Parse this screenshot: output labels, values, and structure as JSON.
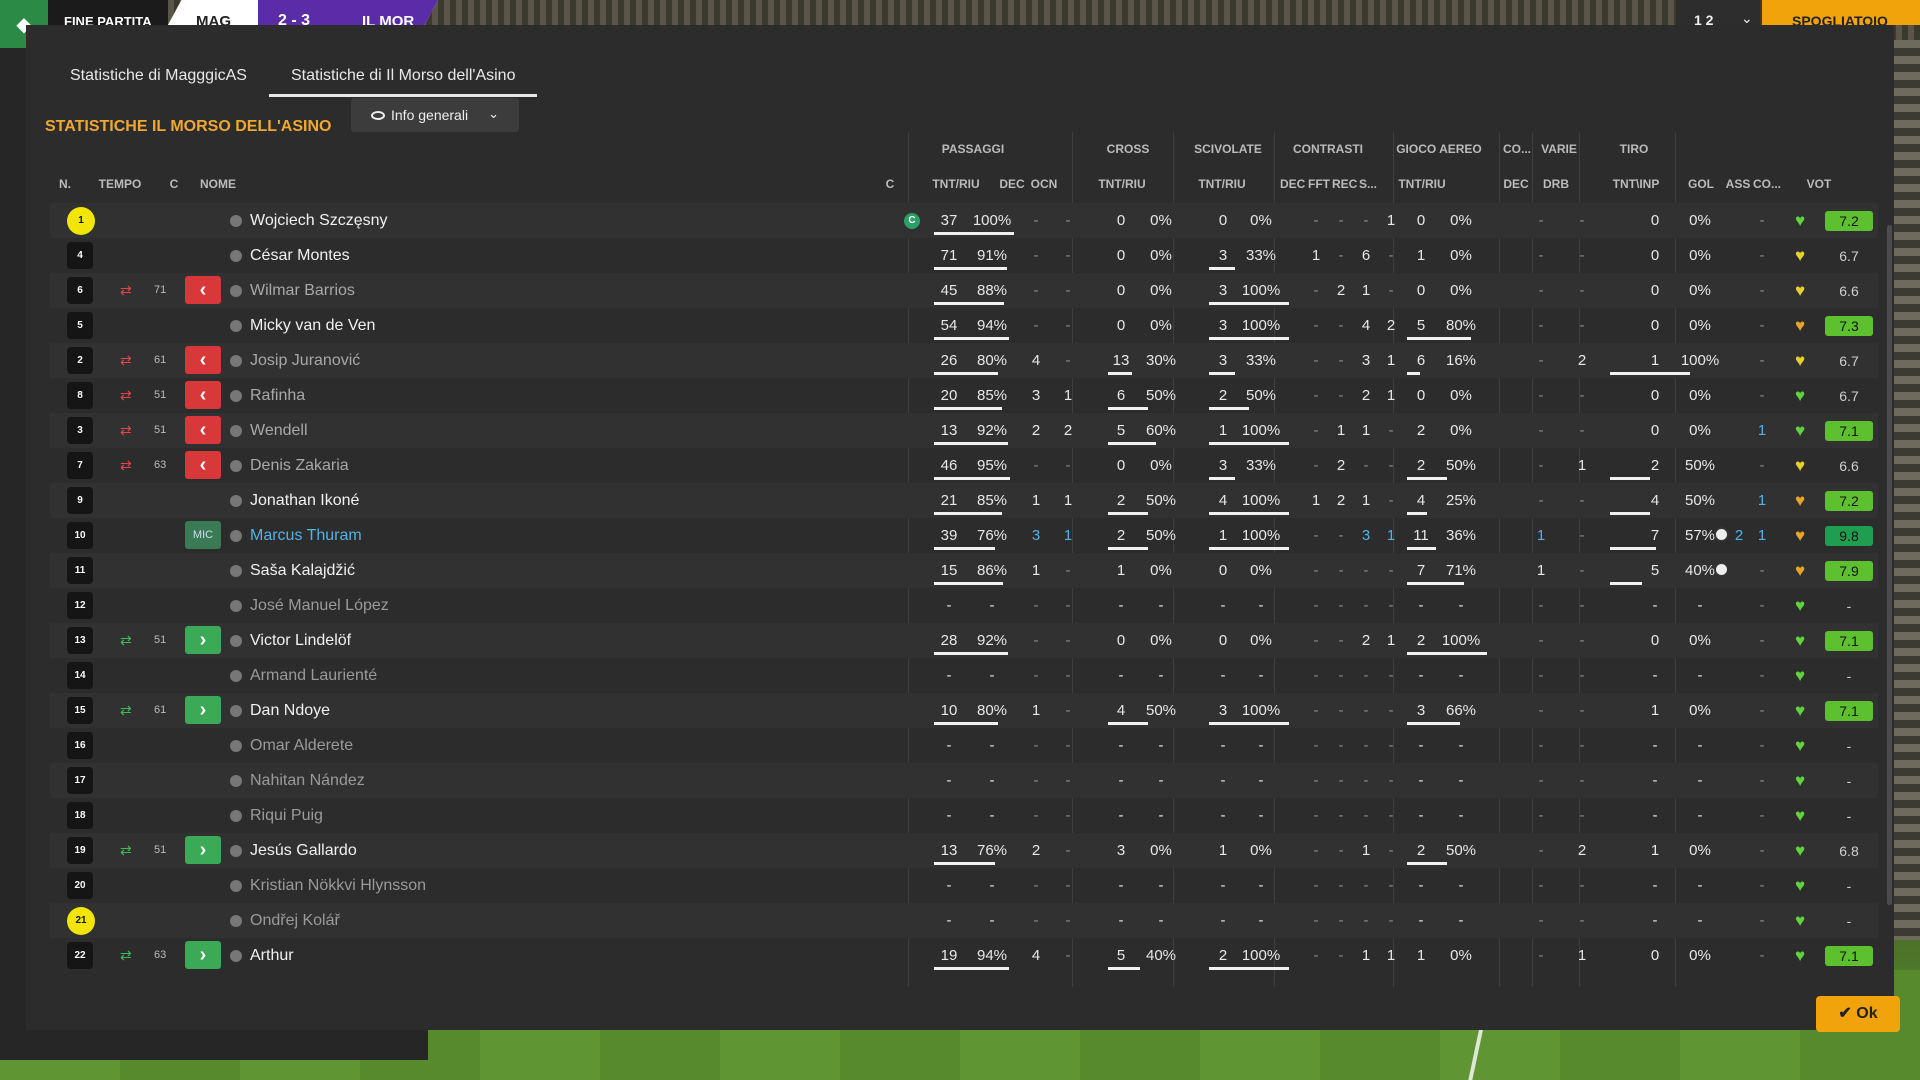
{
  "topbar": {
    "status": "FINE PARTITA",
    "home_abbr": "MAG",
    "score": "2 - 3",
    "away_abbr": "IL MOR",
    "btn_count": "1 2",
    "btn_chevron": "⌄",
    "btn_action": "SPOGLIATOIO"
  },
  "tabs": [
    "Statistiche di MagggicAS",
    "Statistiche di Il Morso dell'Asino"
  ],
  "heading": "STATISTICHE IL MORSO DELL'ASINO",
  "dropdown": "Info generali",
  "group_headers": [
    "PASSAGGI",
    "CROSS",
    "SCIVOLATE",
    "CONTRASTI",
    "GIOCO AEREO",
    "CO...",
    "VARIE",
    "TIRO"
  ],
  "col_headers": [
    "N.",
    "TEMPO",
    "C",
    "NOME",
    "C",
    "TNT/RIU",
    "DEC",
    "OCN",
    "TNT/RIU",
    "TNT/RIU",
    "DEC",
    "FFT",
    "REC",
    "S...",
    "TNT/RIU",
    "DEC",
    "DRB",
    "TNT\\INP",
    "GOL",
    "ASS",
    "CO...",
    "VOT"
  ],
  "colors": {
    "accent": "#f0a830",
    "sub_in": "#3ba955",
    "sub_out": "#d8383a",
    "gk": "#f2e600"
  },
  "rows": [
    {
      "n": "1",
      "gk": true,
      "sub": "",
      "min": "",
      "tag": "",
      "name": "Wojciech Szczęsny",
      "style": "",
      "cap": "C",
      "pass": [
        "37",
        "100%"
      ],
      "pdec": "-",
      "pocn": "-",
      "cross": [
        "0",
        "0%"
      ],
      "slide": [
        "0",
        "0%"
      ],
      "tack": [
        "-",
        "-",
        "-",
        "1"
      ],
      "aer": [
        "0",
        "0%"
      ],
      "co": "-",
      "drb": "-",
      "shot": [
        "0",
        "0%"
      ],
      "gol": "",
      "ass": "-",
      "heart": "green",
      "vot": "7.2",
      "votc": "#5dc12f",
      "pb": 100,
      "cb": 0,
      "sb": 0,
      "ab": 0,
      "tb": 0
    },
    {
      "n": "4",
      "gk": false,
      "sub": "",
      "min": "",
      "tag": "",
      "name": "César Montes",
      "style": "",
      "cap": "",
      "pass": [
        "71",
        "91%"
      ],
      "pdec": "-",
      "pocn": "-",
      "cross": [
        "0",
        "0%"
      ],
      "slide": [
        "3",
        "33%"
      ],
      "tack": [
        "1",
        "-",
        "6",
        "-"
      ],
      "aer": [
        "1",
        "0%"
      ],
      "co": "-",
      "drb": "-",
      "shot": [
        "0",
        "0%"
      ],
      "gol": "",
      "ass": "-",
      "heart": "yellow",
      "vot": "6.7",
      "votc": "",
      "pb": 91,
      "cb": 0,
      "sb": 33,
      "ab": 0,
      "tb": 0
    },
    {
      "n": "6",
      "gk": false,
      "sub": "out",
      "min": "71",
      "tag": "",
      "name": "Wilmar Barrios",
      "style": "subbed",
      "cap": "",
      "pass": [
        "45",
        "88%"
      ],
      "pdec": "-",
      "pocn": "-",
      "cross": [
        "0",
        "0%"
      ],
      "slide": [
        "3",
        "100%"
      ],
      "tack": [
        "-",
        "2",
        "1",
        "-"
      ],
      "aer": [
        "0",
        "0%"
      ],
      "co": "-",
      "drb": "-",
      "shot": [
        "0",
        "0%"
      ],
      "gol": "",
      "ass": "-",
      "heart": "yellow",
      "vot": "6.6",
      "votc": "",
      "pb": 88,
      "cb": 0,
      "sb": 100,
      "ab": 0,
      "tb": 0
    },
    {
      "n": "5",
      "gk": false,
      "sub": "",
      "min": "",
      "tag": "",
      "name": "Micky van de Ven",
      "style": "",
      "cap": "",
      "pass": [
        "54",
        "94%"
      ],
      "pdec": "-",
      "pocn": "-",
      "cross": [
        "0",
        "0%"
      ],
      "slide": [
        "3",
        "100%"
      ],
      "tack": [
        "-",
        "-",
        "4",
        "2"
      ],
      "aer": [
        "5",
        "80%"
      ],
      "co": "-",
      "drb": "-",
      "shot": [
        "0",
        "0%"
      ],
      "gol": "",
      "ass": "-",
      "heart": "orange",
      "vot": "7.3",
      "votc": "#5dc12f",
      "pb": 94,
      "cb": 0,
      "sb": 100,
      "ab": 80,
      "tb": 0
    },
    {
      "n": "2",
      "gk": false,
      "sub": "out",
      "min": "61",
      "tag": "",
      "name": "Josip Juranović",
      "style": "subbed",
      "cap": "",
      "pass": [
        "26",
        "80%"
      ],
      "pdec": "4",
      "pocn": "-",
      "cross": [
        "13",
        "30%"
      ],
      "slide": [
        "3",
        "33%"
      ],
      "tack": [
        "-",
        "-",
        "3",
        "1"
      ],
      "aer": [
        "6",
        "16%"
      ],
      "co": "-",
      "drb": "2",
      "shot": [
        "1",
        "100%"
      ],
      "gol": "",
      "ass": "-",
      "heart": "yellow",
      "vot": "6.7",
      "votc": "",
      "pb": 80,
      "cb": 30,
      "sb": 33,
      "ab": 16,
      "tb": 100
    },
    {
      "n": "8",
      "gk": false,
      "sub": "out",
      "min": "51",
      "tag": "",
      "name": "Rafinha",
      "style": "subbed",
      "cap": "",
      "pass": [
        "20",
        "85%"
      ],
      "pdec": "3",
      "pocn": "1",
      "cross": [
        "6",
        "50%"
      ],
      "slide": [
        "2",
        "50%"
      ],
      "tack": [
        "-",
        "-",
        "2",
        "1"
      ],
      "aer": [
        "0",
        "0%"
      ],
      "co": "-",
      "drb": "-",
      "shot": [
        "0",
        "0%"
      ],
      "gol": "",
      "ass": "-",
      "heart": "green",
      "vot": "6.7",
      "votc": "",
      "pb": 85,
      "cb": 50,
      "sb": 50,
      "ab": 0,
      "tb": 0
    },
    {
      "n": "3",
      "gk": false,
      "sub": "out",
      "min": "51",
      "tag": "",
      "name": "Wendell",
      "style": "subbed",
      "cap": "",
      "pass": [
        "13",
        "92%"
      ],
      "pdec": "2",
      "pocn": "2",
      "cross": [
        "5",
        "60%"
      ],
      "slide": [
        "1",
        "100%"
      ],
      "tack": [
        "-",
        "1",
        "1",
        "-"
      ],
      "aer": [
        "2",
        "0%"
      ],
      "co": "-",
      "drb": "-",
      "shot": [
        "0",
        "0%"
      ],
      "gol": "",
      "ass": "1",
      "heart": "green",
      "vot": "7.1",
      "votc": "#5dc12f",
      "pb": 92,
      "cb": 60,
      "sb": 100,
      "ab": 0,
      "tb": 0
    },
    {
      "n": "7",
      "gk": false,
      "sub": "out",
      "min": "63",
      "tag": "",
      "name": "Denis Zakaria",
      "style": "subbed",
      "cap": "",
      "pass": [
        "46",
        "95%"
      ],
      "pdec": "-",
      "pocn": "-",
      "cross": [
        "0",
        "0%"
      ],
      "slide": [
        "3",
        "33%"
      ],
      "tack": [
        "-",
        "2",
        "-",
        "-"
      ],
      "aer": [
        "2",
        "50%"
      ],
      "co": "-",
      "drb": "1",
      "shot": [
        "2",
        "50%"
      ],
      "gol": "",
      "ass": "-",
      "heart": "yellow",
      "vot": "6.6",
      "votc": "",
      "pb": 95,
      "cb": 0,
      "sb": 33,
      "ab": 50,
      "tb": 50
    },
    {
      "n": "9",
      "gk": false,
      "sub": "",
      "min": "",
      "tag": "",
      "name": "Jonathan Ikoné",
      "style": "",
      "cap": "",
      "pass": [
        "21",
        "85%"
      ],
      "pdec": "1",
      "pocn": "1",
      "cross": [
        "2",
        "50%"
      ],
      "slide": [
        "4",
        "100%"
      ],
      "tack": [
        "1",
        "2",
        "1",
        "-"
      ],
      "aer": [
        "4",
        "25%"
      ],
      "co": "-",
      "drb": "-",
      "shot": [
        "4",
        "50%"
      ],
      "gol": "",
      "ass": "1",
      "heart": "orange",
      "vot": "7.2",
      "votc": "#5dc12f",
      "pb": 85,
      "cb": 50,
      "sb": 100,
      "ab": 25,
      "tb": 50
    },
    {
      "n": "10",
      "gk": false,
      "sub": "",
      "min": "",
      "tag": "MIC",
      "name": "Marcus Thuram",
      "style": "star",
      "cap": "",
      "pass": [
        "39",
        "76%"
      ],
      "pdec": "3",
      "pocn": "1",
      "cross": [
        "2",
        "50%"
      ],
      "slide": [
        "1",
        "100%"
      ],
      "tack": [
        "-",
        "-",
        "3",
        "1"
      ],
      "aer": [
        "11",
        "36%"
      ],
      "co": "1",
      "drb": "-",
      "shot": [
        "7",
        "57%"
      ],
      "gol": "2",
      "ass": "1",
      "heart": "orange",
      "vot": "9.8",
      "votc": "#1f9e4f",
      "pb": 76,
      "cb": 50,
      "sb": 100,
      "ab": 36,
      "tb": 57
    },
    {
      "n": "11",
      "gk": false,
      "sub": "",
      "min": "",
      "tag": "",
      "name": "Saša Kalajdžić",
      "style": "",
      "cap": "",
      "pass": [
        "15",
        "86%"
      ],
      "pdec": "1",
      "pocn": "-",
      "cross": [
        "1",
        "0%"
      ],
      "slide": [
        "0",
        "0%"
      ],
      "tack": [
        "-",
        "-",
        "-",
        "-"
      ],
      "aer": [
        "7",
        "71%"
      ],
      "co": "1",
      "drb": "-",
      "shot": [
        "5",
        "40%"
      ],
      "gol": "1",
      "ass": "-",
      "heart": "orange",
      "vot": "7.9",
      "votc": "#5dc12f",
      "pb": 86,
      "cb": 0,
      "sb": 0,
      "ab": 71,
      "tb": 40
    },
    {
      "n": "12",
      "gk": false,
      "sub": "",
      "min": "",
      "tag": "",
      "name": "José Manuel López",
      "style": "unused",
      "cap": "",
      "pass": [
        "-",
        "-"
      ],
      "pdec": "-",
      "pocn": "-",
      "cross": [
        "-",
        "-"
      ],
      "slide": [
        "-",
        "-"
      ],
      "tack": [
        "-",
        "-",
        "-",
        "-"
      ],
      "aer": [
        "-",
        "-"
      ],
      "co": "-",
      "drb": "-",
      "shot": [
        "-",
        "-"
      ],
      "gol": "",
      "ass": "-",
      "heart": "green",
      "vot": "-",
      "votc": "",
      "pb": 0,
      "cb": 0,
      "sb": 0,
      "ab": 0,
      "tb": 0
    },
    {
      "n": "13",
      "gk": false,
      "sub": "in",
      "min": "51",
      "tag": "",
      "name": "Victor Lindelöf",
      "style": "",
      "cap": "",
      "pass": [
        "28",
        "92%"
      ],
      "pdec": "-",
      "pocn": "-",
      "cross": [
        "0",
        "0%"
      ],
      "slide": [
        "0",
        "0%"
      ],
      "tack": [
        "-",
        "-",
        "2",
        "1"
      ],
      "aer": [
        "2",
        "100%"
      ],
      "co": "-",
      "drb": "-",
      "shot": [
        "0",
        "0%"
      ],
      "gol": "",
      "ass": "-",
      "heart": "green",
      "vot": "7.1",
      "votc": "#5dc12f",
      "pb": 92,
      "cb": 0,
      "sb": 0,
      "ab": 100,
      "tb": 0
    },
    {
      "n": "14",
      "gk": false,
      "sub": "",
      "min": "",
      "tag": "",
      "name": "Armand Laurienté",
      "style": "unused",
      "cap": "",
      "pass": [
        "-",
        "-"
      ],
      "pdec": "-",
      "pocn": "-",
      "cross": [
        "-",
        "-"
      ],
      "slide": [
        "-",
        "-"
      ],
      "tack": [
        "-",
        "-",
        "-",
        "-"
      ],
      "aer": [
        "-",
        "-"
      ],
      "co": "-",
      "drb": "-",
      "shot": [
        "-",
        "-"
      ],
      "gol": "",
      "ass": "-",
      "heart": "green",
      "vot": "-",
      "votc": "",
      "pb": 0,
      "cb": 0,
      "sb": 0,
      "ab": 0,
      "tb": 0
    },
    {
      "n": "15",
      "gk": false,
      "sub": "in",
      "min": "61",
      "tag": "",
      "name": "Dan Ndoye",
      "style": "",
      "cap": "",
      "pass": [
        "10",
        "80%"
      ],
      "pdec": "1",
      "pocn": "-",
      "cross": [
        "4",
        "50%"
      ],
      "slide": [
        "3",
        "100%"
      ],
      "tack": [
        "-",
        "-",
        "-",
        "-"
      ],
      "aer": [
        "3",
        "66%"
      ],
      "co": "-",
      "drb": "-",
      "shot": [
        "1",
        "0%"
      ],
      "gol": "",
      "ass": "-",
      "heart": "green",
      "vot": "7.1",
      "votc": "#5dc12f",
      "pb": 80,
      "cb": 50,
      "sb": 100,
      "ab": 66,
      "tb": 0
    },
    {
      "n": "16",
      "gk": false,
      "sub": "",
      "min": "",
      "tag": "",
      "name": "Omar Alderete",
      "style": "unused",
      "cap": "",
      "pass": [
        "-",
        "-"
      ],
      "pdec": "-",
      "pocn": "-",
      "cross": [
        "-",
        "-"
      ],
      "slide": [
        "-",
        "-"
      ],
      "tack": [
        "-",
        "-",
        "-",
        "-"
      ],
      "aer": [
        "-",
        "-"
      ],
      "co": "-",
      "drb": "-",
      "shot": [
        "-",
        "-"
      ],
      "gol": "",
      "ass": "-",
      "heart": "green",
      "vot": "-",
      "votc": "",
      "pb": 0,
      "cb": 0,
      "sb": 0,
      "ab": 0,
      "tb": 0
    },
    {
      "n": "17",
      "gk": false,
      "sub": "",
      "min": "",
      "tag": "",
      "name": "Nahitan Nández",
      "style": "unused",
      "cap": "",
      "pass": [
        "-",
        "-"
      ],
      "pdec": "-",
      "pocn": "-",
      "cross": [
        "-",
        "-"
      ],
      "slide": [
        "-",
        "-"
      ],
      "tack": [
        "-",
        "-",
        "-",
        "-"
      ],
      "aer": [
        "-",
        "-"
      ],
      "co": "-",
      "drb": "-",
      "shot": [
        "-",
        "-"
      ],
      "gol": "",
      "ass": "-",
      "heart": "green",
      "vot": "-",
      "votc": "",
      "pb": 0,
      "cb": 0,
      "sb": 0,
      "ab": 0,
      "tb": 0
    },
    {
      "n": "18",
      "gk": false,
      "sub": "",
      "min": "",
      "tag": "",
      "name": "Riqui Puig",
      "style": "unused",
      "cap": "",
      "pass": [
        "-",
        "-"
      ],
      "pdec": "-",
      "pocn": "-",
      "cross": [
        "-",
        "-"
      ],
      "slide": [
        "-",
        "-"
      ],
      "tack": [
        "-",
        "-",
        "-",
        "-"
      ],
      "aer": [
        "-",
        "-"
      ],
      "co": "-",
      "drb": "-",
      "shot": [
        "-",
        "-"
      ],
      "gol": "",
      "ass": "-",
      "heart": "green",
      "vot": "-",
      "votc": "",
      "pb": 0,
      "cb": 0,
      "sb": 0,
      "ab": 0,
      "tb": 0
    },
    {
      "n": "19",
      "gk": false,
      "sub": "in",
      "min": "51",
      "tag": "",
      "name": "Jesús Gallardo",
      "style": "",
      "cap": "",
      "pass": [
        "13",
        "76%"
      ],
      "pdec": "2",
      "pocn": "-",
      "cross": [
        "3",
        "0%"
      ],
      "slide": [
        "1",
        "0%"
      ],
      "tack": [
        "-",
        "-",
        "1",
        "-"
      ],
      "aer": [
        "2",
        "50%"
      ],
      "co": "-",
      "drb": "2",
      "shot": [
        "1",
        "0%"
      ],
      "gol": "",
      "ass": "-",
      "heart": "green",
      "vot": "6.8",
      "votc": "",
      "pb": 76,
      "cb": 0,
      "sb": 0,
      "ab": 50,
      "tb": 0
    },
    {
      "n": "20",
      "gk": false,
      "sub": "",
      "min": "",
      "tag": "",
      "name": "Kristian Nökkvi Hlynsson",
      "style": "unused",
      "cap": "",
      "pass": [
        "-",
        "-"
      ],
      "pdec": "-",
      "pocn": "-",
      "cross": [
        "-",
        "-"
      ],
      "slide": [
        "-",
        "-"
      ],
      "tack": [
        "-",
        "-",
        "-",
        "-"
      ],
      "aer": [
        "-",
        "-"
      ],
      "co": "-",
      "drb": "-",
      "shot": [
        "-",
        "-"
      ],
      "gol": "",
      "ass": "-",
      "heart": "green",
      "vot": "-",
      "votc": "",
      "pb": 0,
      "cb": 0,
      "sb": 0,
      "ab": 0,
      "tb": 0
    },
    {
      "n": "21",
      "gk": true,
      "sub": "",
      "min": "",
      "tag": "",
      "name": "Ondřej Kolář",
      "style": "unused",
      "cap": "",
      "pass": [
        "-",
        "-"
      ],
      "pdec": "-",
      "pocn": "-",
      "cross": [
        "-",
        "-"
      ],
      "slide": [
        "-",
        "-"
      ],
      "tack": [
        "-",
        "-",
        "-",
        "-"
      ],
      "aer": [
        "-",
        "-"
      ],
      "co": "-",
      "drb": "-",
      "shot": [
        "-",
        "-"
      ],
      "gol": "",
      "ass": "-",
      "heart": "green",
      "vot": "-",
      "votc": "",
      "pb": 0,
      "cb": 0,
      "sb": 0,
      "ab": 0,
      "tb": 0
    },
    {
      "n": "22",
      "gk": false,
      "sub": "in",
      "min": "63",
      "tag": "",
      "name": "Arthur",
      "style": "",
      "cap": "",
      "pass": [
        "19",
        "94%"
      ],
      "pdec": "4",
      "pocn": "-",
      "cross": [
        "5",
        "40%"
      ],
      "slide": [
        "2",
        "100%"
      ],
      "tack": [
        "-",
        "-",
        "1",
        "1"
      ],
      "aer": [
        "1",
        "0%"
      ],
      "co": "-",
      "drb": "1",
      "shot": [
        "0",
        "0%"
      ],
      "gol": "",
      "ass": "-",
      "heart": "green",
      "vot": "7.1",
      "votc": "#5dc12f",
      "pb": 94,
      "cb": 40,
      "sb": 100,
      "ab": 0,
      "tb": 0
    }
  ],
  "ok_label": "Ok"
}
